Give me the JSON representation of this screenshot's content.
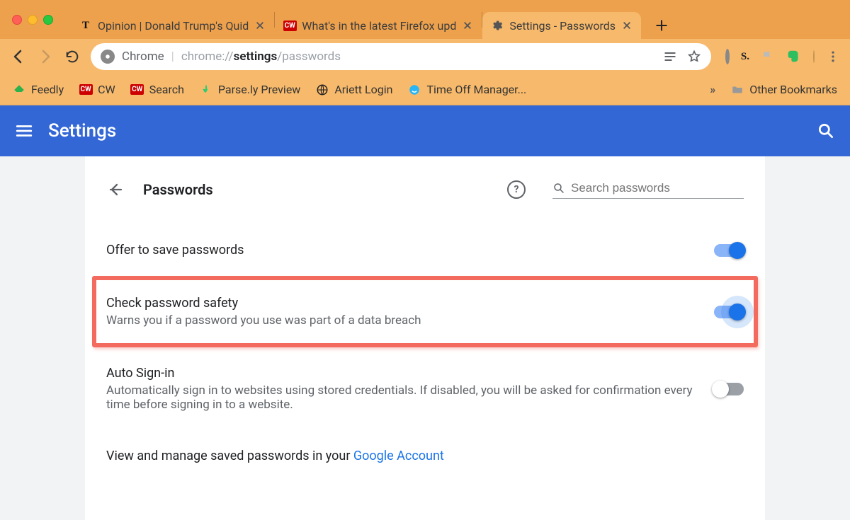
{
  "tabs": [
    {
      "label": "Opinion | Donald Trump's Quid",
      "favicon": "nyt"
    },
    {
      "label": "What's in the latest Firefox upd",
      "favicon": "cw"
    },
    {
      "label": "Settings - Passwords",
      "favicon": "gear"
    }
  ],
  "address_bar": {
    "chip_label": "Chrome",
    "url_pre": "chrome://",
    "url_bold": "settings",
    "url_post": "/passwords"
  },
  "bookmarks": [
    {
      "label": "Feedly",
      "icon": "feedly"
    },
    {
      "label": "CW",
      "icon": "cw"
    },
    {
      "label": "Search",
      "icon": "cw"
    },
    {
      "label": "Parse.ly Preview",
      "icon": "parsely"
    },
    {
      "label": "Ariett Login",
      "icon": "globe"
    },
    {
      "label": "Time Off Manager...",
      "icon": "blue"
    }
  ],
  "other_bookmarks_label": "Other Bookmarks",
  "settings_header_title": "Settings",
  "section_title": "Passwords",
  "search_placeholder": "Search passwords",
  "rows": {
    "offer": {
      "title": "Offer to save passwords"
    },
    "check": {
      "title": "Check password safety",
      "sub": "Warns you if a password you use was part of a data breach"
    },
    "auto": {
      "title": "Auto Sign-in",
      "sub": "Automatically sign in to websites using stored credentials. If disabled, you will be asked for confirmation every time before signing in to a website."
    },
    "manage": {
      "pre": "View and manage saved passwords in your ",
      "link": "Google Account"
    }
  }
}
